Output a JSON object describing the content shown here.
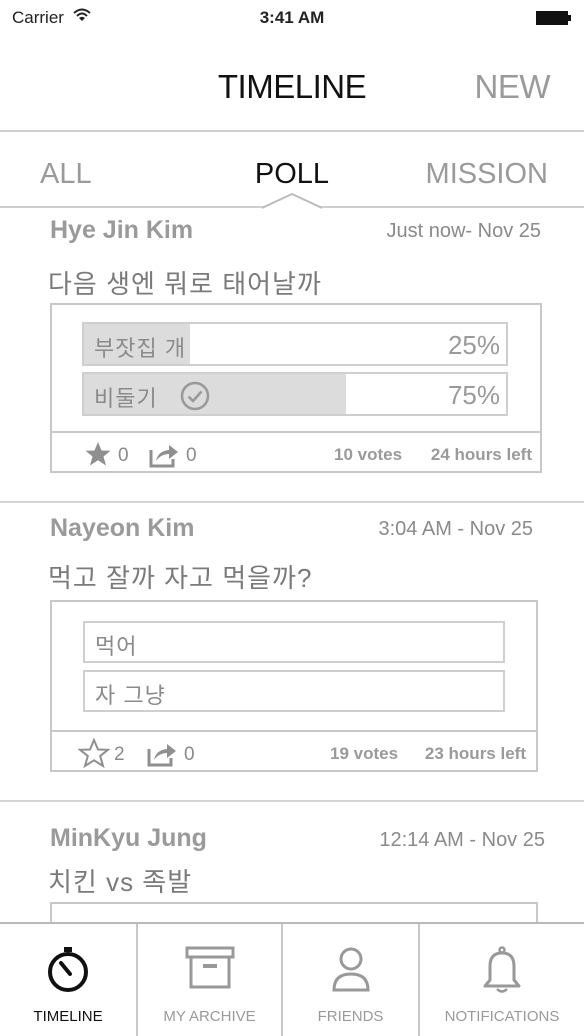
{
  "status_bar": {
    "carrier": "Carrier",
    "time": "3:41 AM"
  },
  "nav": {
    "title": "TIMELINE",
    "new_label": "NEW"
  },
  "segments": {
    "all": "ALL",
    "poll": "POLL",
    "mission": "MISSION",
    "selected": "POLL"
  },
  "posts": [
    {
      "author": "Hye Jin Kim",
      "time": "Just now- Nov 25",
      "question": "다음 생엔 뭐로 태어날까",
      "options": [
        {
          "label": "부잣집 개",
          "percent_text": "25%",
          "percent": 25
        },
        {
          "label": "비둘기",
          "percent_text": "75%",
          "percent": 75,
          "voted": true
        }
      ],
      "stars": "0",
      "shares": "0",
      "votes": "10 votes",
      "time_left": "24 hours left"
    },
    {
      "author": "Nayeon Kim",
      "time": "3:04 AM - Nov 25",
      "question": "먹고 잘까 자고 먹을까?",
      "options": [
        {
          "label": "먹어"
        },
        {
          "label": "자 그냥"
        }
      ],
      "stars": "2",
      "shares": "0",
      "votes": "19 votes",
      "time_left": "23 hours left"
    },
    {
      "author": "MinKyu Jung",
      "time": "12:14 AM - Nov 25",
      "question": "치킨 vs 족발"
    }
  ],
  "tabs": [
    {
      "label": "TIMELINE",
      "icon": "timer-icon",
      "active": true
    },
    {
      "label": "MY ARCHIVE",
      "icon": "archive-box-icon"
    },
    {
      "label": "FRIENDS",
      "icon": "person-icon"
    },
    {
      "label": "NOTIFICATIONS",
      "icon": "bell-icon"
    }
  ]
}
